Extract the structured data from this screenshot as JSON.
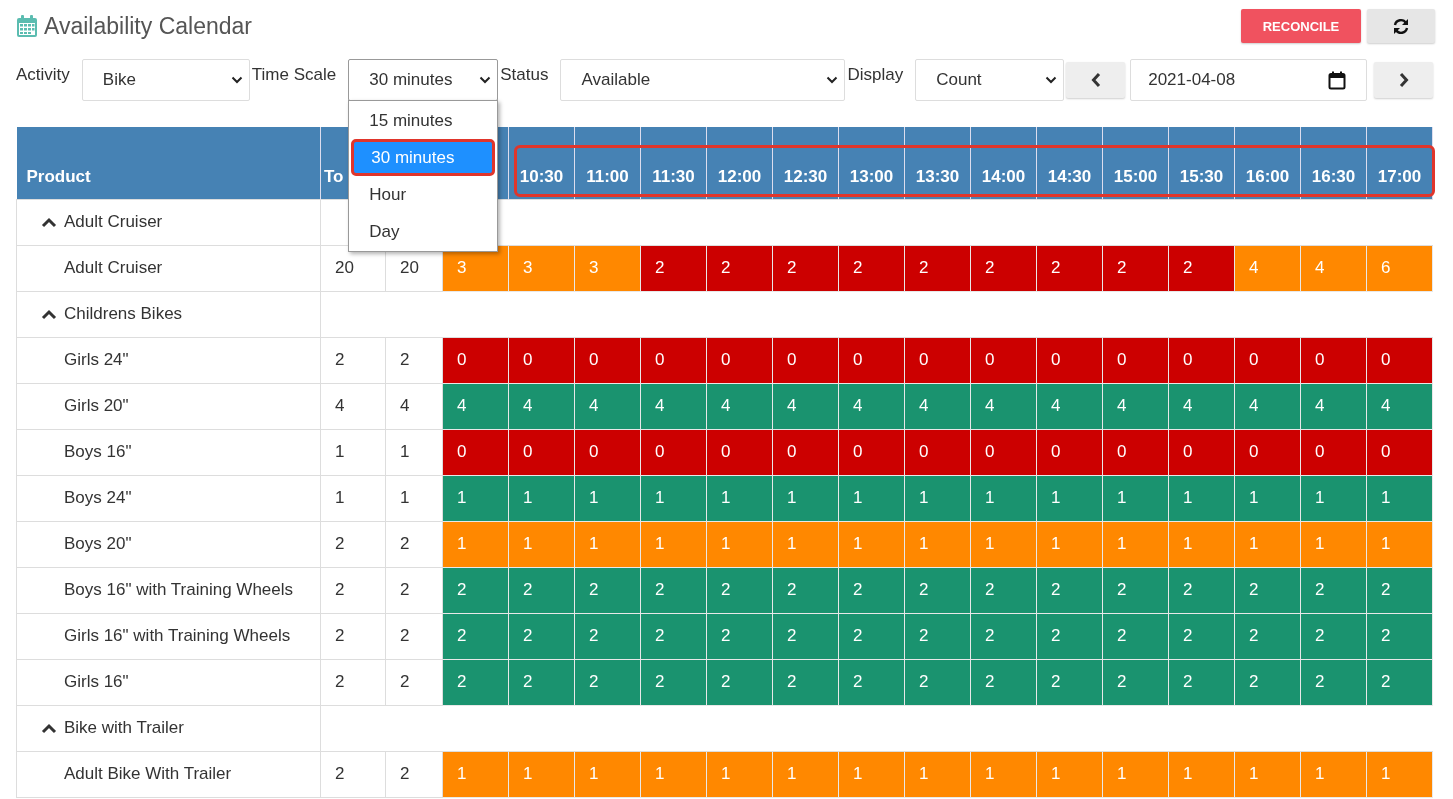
{
  "title": "Availability Calendar",
  "actions": [
    {
      "kind": "text",
      "label": "RECONCILE"
    },
    {
      "kind": "refresh"
    }
  ],
  "filters": [
    {
      "label": "Activity",
      "value": "Bike"
    },
    {
      "label": "Time Scale",
      "value": "30 minutes",
      "open": true,
      "options": [
        {
          "label": "15 minutes",
          "selected": false
        },
        {
          "label": "30 minutes",
          "selected": true
        },
        {
          "label": "Hour",
          "selected": false
        },
        {
          "label": "Day",
          "selected": false
        }
      ]
    },
    {
      "label": "Status",
      "value": "Available"
    },
    {
      "label": "Display",
      "value": "Count"
    }
  ],
  "date": "2021-04-08",
  "table": {
    "columns": [
      "Product",
      "To"
    ],
    "time_columns": [
      "10:30",
      "11:00",
      "11:30",
      "12:00",
      "12:30",
      "13:00",
      "13:30",
      "14:00",
      "14:30",
      "15:00",
      "15:30",
      "16:00",
      "16:30",
      "17:00"
    ],
    "time_columns_highlighted": true,
    "groups": [
      {
        "label": "Adult Cruiser",
        "expanded": true,
        "rows": [
          {
            "name": "Adult Cruiser",
            "total": "20",
            "available": "20",
            "cells": [
              {
                "v": "3",
                "color": "#ff8800"
              },
              {
                "v": "3",
                "color": "#ff8800"
              },
              {
                "v": "3",
                "color": "#ff8800"
              },
              {
                "v": "2",
                "color": "#cc0000"
              },
              {
                "v": "2",
                "color": "#cc0000"
              },
              {
                "v": "2",
                "color": "#cc0000"
              },
              {
                "v": "2",
                "color": "#cc0000"
              },
              {
                "v": "2",
                "color": "#cc0000"
              },
              {
                "v": "2",
                "color": "#cc0000"
              },
              {
                "v": "2",
                "color": "#cc0000"
              },
              {
                "v": "2",
                "color": "#cc0000"
              },
              {
                "v": "2",
                "color": "#cc0000"
              },
              {
                "v": "4",
                "color": "#ff8800"
              },
              {
                "v": "4",
                "color": "#ff8800"
              },
              {
                "v": "6",
                "color": "#ff8800"
              }
            ]
          }
        ]
      },
      {
        "label": "Childrens Bikes",
        "expanded": true,
        "rows": [
          {
            "name": "Girls 24\"",
            "total": "2",
            "available": "2",
            "cells": [
              {
                "v": "0",
                "color": "#cc0000"
              },
              {
                "v": "0",
                "color": "#cc0000"
              },
              {
                "v": "0",
                "color": "#cc0000"
              },
              {
                "v": "0",
                "color": "#cc0000"
              },
              {
                "v": "0",
                "color": "#cc0000"
              },
              {
                "v": "0",
                "color": "#cc0000"
              },
              {
                "v": "0",
                "color": "#cc0000"
              },
              {
                "v": "0",
                "color": "#cc0000"
              },
              {
                "v": "0",
                "color": "#cc0000"
              },
              {
                "v": "0",
                "color": "#cc0000"
              },
              {
                "v": "0",
                "color": "#cc0000"
              },
              {
                "v": "0",
                "color": "#cc0000"
              },
              {
                "v": "0",
                "color": "#cc0000"
              },
              {
                "v": "0",
                "color": "#cc0000"
              },
              {
                "v": "0",
                "color": "#cc0000"
              }
            ]
          },
          {
            "name": "Girls 20\"",
            "total": "4",
            "available": "4",
            "cells": [
              {
                "v": "4",
                "color": "#1a936f"
              },
              {
                "v": "4",
                "color": "#1a936f"
              },
              {
                "v": "4",
                "color": "#1a936f"
              },
              {
                "v": "4",
                "color": "#1a936f"
              },
              {
                "v": "4",
                "color": "#1a936f"
              },
              {
                "v": "4",
                "color": "#1a936f"
              },
              {
                "v": "4",
                "color": "#1a936f"
              },
              {
                "v": "4",
                "color": "#1a936f"
              },
              {
                "v": "4",
                "color": "#1a936f"
              },
              {
                "v": "4",
                "color": "#1a936f"
              },
              {
                "v": "4",
                "color": "#1a936f"
              },
              {
                "v": "4",
                "color": "#1a936f"
              },
              {
                "v": "4",
                "color": "#1a936f"
              },
              {
                "v": "4",
                "color": "#1a936f"
              },
              {
                "v": "4",
                "color": "#1a936f"
              }
            ]
          },
          {
            "name": "Boys 16\"",
            "total": "1",
            "available": "1",
            "cells": [
              {
                "v": "0",
                "color": "#cc0000"
              },
              {
                "v": "0",
                "color": "#cc0000"
              },
              {
                "v": "0",
                "color": "#cc0000"
              },
              {
                "v": "0",
                "color": "#cc0000"
              },
              {
                "v": "0",
                "color": "#cc0000"
              },
              {
                "v": "0",
                "color": "#cc0000"
              },
              {
                "v": "0",
                "color": "#cc0000"
              },
              {
                "v": "0",
                "color": "#cc0000"
              },
              {
                "v": "0",
                "color": "#cc0000"
              },
              {
                "v": "0",
                "color": "#cc0000"
              },
              {
                "v": "0",
                "color": "#cc0000"
              },
              {
                "v": "0",
                "color": "#cc0000"
              },
              {
                "v": "0",
                "color": "#cc0000"
              },
              {
                "v": "0",
                "color": "#cc0000"
              },
              {
                "v": "0",
                "color": "#cc0000"
              }
            ]
          },
          {
            "name": "Boys 24\"",
            "total": "1",
            "available": "1",
            "cells": [
              {
                "v": "1",
                "color": "#1a936f"
              },
              {
                "v": "1",
                "color": "#1a936f"
              },
              {
                "v": "1",
                "color": "#1a936f"
              },
              {
                "v": "1",
                "color": "#1a936f"
              },
              {
                "v": "1",
                "color": "#1a936f"
              },
              {
                "v": "1",
                "color": "#1a936f"
              },
              {
                "v": "1",
                "color": "#1a936f"
              },
              {
                "v": "1",
                "color": "#1a936f"
              },
              {
                "v": "1",
                "color": "#1a936f"
              },
              {
                "v": "1",
                "color": "#1a936f"
              },
              {
                "v": "1",
                "color": "#1a936f"
              },
              {
                "v": "1",
                "color": "#1a936f"
              },
              {
                "v": "1",
                "color": "#1a936f"
              },
              {
                "v": "1",
                "color": "#1a936f"
              },
              {
                "v": "1",
                "color": "#1a936f"
              }
            ]
          },
          {
            "name": "Boys 20\"",
            "total": "2",
            "available": "2",
            "cells": [
              {
                "v": "1",
                "color": "#ff8800"
              },
              {
                "v": "1",
                "color": "#ff8800"
              },
              {
                "v": "1",
                "color": "#ff8800"
              },
              {
                "v": "1",
                "color": "#ff8800"
              },
              {
                "v": "1",
                "color": "#ff8800"
              },
              {
                "v": "1",
                "color": "#ff8800"
              },
              {
                "v": "1",
                "color": "#ff8800"
              },
              {
                "v": "1",
                "color": "#ff8800"
              },
              {
                "v": "1",
                "color": "#ff8800"
              },
              {
                "v": "1",
                "color": "#ff8800"
              },
              {
                "v": "1",
                "color": "#ff8800"
              },
              {
                "v": "1",
                "color": "#ff8800"
              },
              {
                "v": "1",
                "color": "#ff8800"
              },
              {
                "v": "1",
                "color": "#ff8800"
              },
              {
                "v": "1",
                "color": "#ff8800"
              }
            ]
          },
          {
            "name": "Boys 16\" with Training Wheels",
            "total": "2",
            "available": "2",
            "cells": [
              {
                "v": "2",
                "color": "#1a936f"
              },
              {
                "v": "2",
                "color": "#1a936f"
              },
              {
                "v": "2",
                "color": "#1a936f"
              },
              {
                "v": "2",
                "color": "#1a936f"
              },
              {
                "v": "2",
                "color": "#1a936f"
              },
              {
                "v": "2",
                "color": "#1a936f"
              },
              {
                "v": "2",
                "color": "#1a936f"
              },
              {
                "v": "2",
                "color": "#1a936f"
              },
              {
                "v": "2",
                "color": "#1a936f"
              },
              {
                "v": "2",
                "color": "#1a936f"
              },
              {
                "v": "2",
                "color": "#1a936f"
              },
              {
                "v": "2",
                "color": "#1a936f"
              },
              {
                "v": "2",
                "color": "#1a936f"
              },
              {
                "v": "2",
                "color": "#1a936f"
              },
              {
                "v": "2",
                "color": "#1a936f"
              }
            ]
          },
          {
            "name": "Girls 16\" with Training Wheels",
            "total": "2",
            "available": "2",
            "cells": [
              {
                "v": "2",
                "color": "#1a936f"
              },
              {
                "v": "2",
                "color": "#1a936f"
              },
              {
                "v": "2",
                "color": "#1a936f"
              },
              {
                "v": "2",
                "color": "#1a936f"
              },
              {
                "v": "2",
                "color": "#1a936f"
              },
              {
                "v": "2",
                "color": "#1a936f"
              },
              {
                "v": "2",
                "color": "#1a936f"
              },
              {
                "v": "2",
                "color": "#1a936f"
              },
              {
                "v": "2",
                "color": "#1a936f"
              },
              {
                "v": "2",
                "color": "#1a936f"
              },
              {
                "v": "2",
                "color": "#1a936f"
              },
              {
                "v": "2",
                "color": "#1a936f"
              },
              {
                "v": "2",
                "color": "#1a936f"
              },
              {
                "v": "2",
                "color": "#1a936f"
              },
              {
                "v": "2",
                "color": "#1a936f"
              }
            ]
          },
          {
            "name": "Girls 16\"",
            "total": "2",
            "available": "2",
            "cells": [
              {
                "v": "2",
                "color": "#1a936f"
              },
              {
                "v": "2",
                "color": "#1a936f"
              },
              {
                "v": "2",
                "color": "#1a936f"
              },
              {
                "v": "2",
                "color": "#1a936f"
              },
              {
                "v": "2",
                "color": "#1a936f"
              },
              {
                "v": "2",
                "color": "#1a936f"
              },
              {
                "v": "2",
                "color": "#1a936f"
              },
              {
                "v": "2",
                "color": "#1a936f"
              },
              {
                "v": "2",
                "color": "#1a936f"
              },
              {
                "v": "2",
                "color": "#1a936f"
              },
              {
                "v": "2",
                "color": "#1a936f"
              },
              {
                "v": "2",
                "color": "#1a936f"
              },
              {
                "v": "2",
                "color": "#1a936f"
              },
              {
                "v": "2",
                "color": "#1a936f"
              },
              {
                "v": "2",
                "color": "#1a936f"
              }
            ]
          }
        ]
      },
      {
        "label": "Bike with Trailer",
        "expanded": true,
        "rows": [
          {
            "name": "Adult Bike With Trailer",
            "total": "2",
            "available": "2",
            "cells": [
              {
                "v": "1",
                "color": "#ff8800"
              },
              {
                "v": "1",
                "color": "#ff8800"
              },
              {
                "v": "1",
                "color": "#ff8800"
              },
              {
                "v": "1",
                "color": "#ff8800"
              },
              {
                "v": "1",
                "color": "#ff8800"
              },
              {
                "v": "1",
                "color": "#ff8800"
              },
              {
                "v": "1",
                "color": "#ff8800"
              },
              {
                "v": "1",
                "color": "#ff8800"
              },
              {
                "v": "1",
                "color": "#ff8800"
              },
              {
                "v": "1",
                "color": "#ff8800"
              },
              {
                "v": "1",
                "color": "#ff8800"
              },
              {
                "v": "1",
                "color": "#ff8800"
              },
              {
                "v": "1",
                "color": "#ff8800"
              },
              {
                "v": "1",
                "color": "#ff8800"
              },
              {
                "v": "1",
                "color": "#ff8800"
              }
            ]
          }
        ]
      }
    ]
  }
}
